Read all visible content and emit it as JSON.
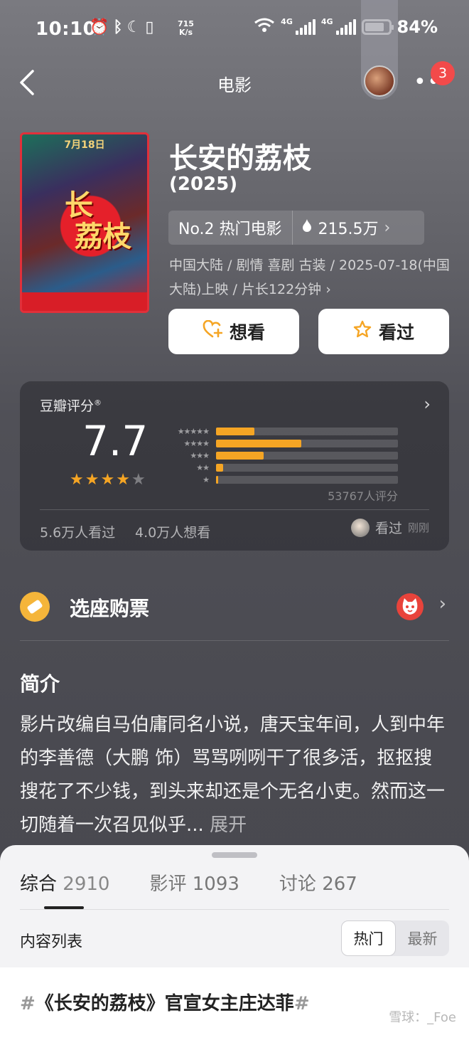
{
  "status_bar": {
    "time": "10:10",
    "net_speed_value": "715",
    "net_speed_unit": "K/s",
    "network_1": "4G",
    "network_2": "4G",
    "battery_percent": "84%",
    "battery_level": 0.84
  },
  "nav": {
    "title": "电影",
    "notification_count": "3"
  },
  "movie": {
    "poster_top_text": "7月18日",
    "poster_title": "长安的荔枝",
    "title": "长安的荔枝",
    "year": "(2025)",
    "rank": "No.2 热门电影",
    "heat": "215.5万",
    "meta": "中国大陆 / 剧情 喜剧 古装 / 2025-07-18(中国大陆)上映 / 片长122分钟 ›"
  },
  "actions": {
    "want_label": "想看",
    "seen_label": "看过"
  },
  "rating": {
    "label": "豆瓣评分",
    "registered_mark": "®",
    "score": "7.7",
    "stars_filled": 4,
    "distribution": [
      {
        "stars": 5,
        "fraction": 0.21
      },
      {
        "stars": 4,
        "fraction": 0.47
      },
      {
        "stars": 3,
        "fraction": 0.26
      },
      {
        "stars": 2,
        "fraction": 0.04
      },
      {
        "stars": 1,
        "fraction": 0.01
      }
    ],
    "count": "53767人评分",
    "seen_count": "5.6万人看过",
    "want_count": "4.0万人想看",
    "friend_action": "看过",
    "friend_time": "刚刚",
    "accent_color": "#f5a524"
  },
  "ticket": {
    "label": "选座购票",
    "partner_icon": "maoyan-cat-icon"
  },
  "synopsis": {
    "title": "简介",
    "text": "影片改编自马伯庸同名小说，唐天宝年间，人到中年的李善德（大鹏 饰）骂骂咧咧干了很多活，抠抠搜搜花了不少钱，到头来却还是个无名小吏。然而这一切随着一次召见似乎... ",
    "expand": "展开"
  },
  "sheet": {
    "tabs": [
      {
        "label": "综合",
        "count": "2910"
      },
      {
        "label": "影评",
        "count": "1093"
      },
      {
        "label": "讨论",
        "count": "267"
      }
    ],
    "list_label": "内容列表",
    "sort_options": [
      "热门",
      "最新"
    ],
    "post_title": "《长安的荔枝》官宣女主庄达菲",
    "hash": "#",
    "watermark": "雪球：_Foe"
  }
}
